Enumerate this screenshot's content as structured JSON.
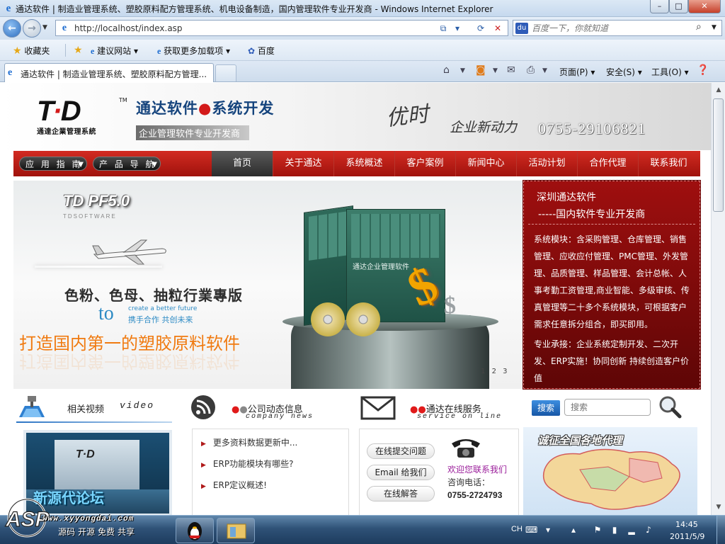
{
  "window": {
    "title": "通达软件 | 制造业管理系统、塑胶原料配方管理系统、机电设备制造，国内管理软件专业开发商 - Windows Internet Explorer"
  },
  "address_bar": {
    "url": "http://localhost/index.asp",
    "search_placeholder": "百度一下，你就知道"
  },
  "favorites_bar": {
    "favorites_label": "收藏夹",
    "items": [
      "建议网站",
      "获取更多加载项",
      "百度"
    ]
  },
  "tabs": [
    {
      "label": "通达软件 | 制造业管理系统、塑胶原料配方管理..."
    }
  ],
  "command_bar": {
    "page": "页面(P)",
    "safety": "安全(S)",
    "tools": "工具(O)"
  },
  "header": {
    "logo_mark": "T·D",
    "logo_tm": "TM",
    "logo_subtitle": "通達企業管理系統",
    "brand_part1": "通达软件",
    "brand_part2": "系统开发",
    "brand_subtitle": "企业管理软件专业开发商",
    "slogan_script": "优时",
    "slogan_script2": "企业新动力",
    "phone": "0755-29106821"
  },
  "nav": {
    "guide_buttons": [
      "应 用 指 南",
      "产 品 导 航"
    ],
    "items": [
      "首页",
      "关于通达",
      "系统概述",
      "客户案例",
      "新闻中心",
      "活动计划",
      "合作代理",
      "联系我们"
    ],
    "active_index": 0
  },
  "banner": {
    "product_name": "TD PF5.0",
    "product_sub": "TDSOFTWARE",
    "edition": "色粉、色母、抽粒行業專版",
    "to": "to",
    "tagline_en": "create a better future",
    "tagline_cn": "携手合作 共创未来",
    "headline": "打造国内第一的塑胶原料软件",
    "box_title": "通达企业管理软件",
    "slides": [
      "1",
      "2",
      "3"
    ]
  },
  "side_panel": {
    "title": "深圳通达软件",
    "subtitle": "-----国内软件专业开发商",
    "modules_text": "系统模块：含采购管理、仓库管理、销售管理、应收应付管理、PMC管理、外发管理、品质管理、样品管理、会计总帐、人事考勤工资管理,商业智能、多级审核、传真管理等二十多个系统模块，可根据客户需求任意拆分组合，即买即用。",
    "services_text": "专业承接：企业系统定制开发、二次开发、ERP实施！协同创新 持续创造客户价值"
  },
  "video_section": {
    "title": "相关视频",
    "title_en": "video",
    "overlay_caption": "新源代论坛"
  },
  "news_section": {
    "title": "公司动态信息",
    "title_en": "company news",
    "items": [
      "更多资料数据更新中...",
      "ERP功能模块有哪些?",
      "ERP定议概述!"
    ]
  },
  "service_section": {
    "title": "通达在线服务",
    "title_en": "service on line",
    "buttons": [
      "在线提交问题",
      "Email 给我们",
      "在线解答"
    ],
    "welcome": "欢迎您联系我们",
    "tel_label": "咨询电话：",
    "tel": "0755-2724793"
  },
  "search_section": {
    "button": "搜索",
    "placeholder": "搜索",
    "map_title": "诚征全国各地代理"
  },
  "watermark": {
    "site": "ASP",
    "url": "www.xyyongdai.com"
  },
  "taskbar": {
    "tags": [
      "源码",
      "开源",
      "免费",
      "共享"
    ],
    "lang": "CH",
    "time": "14:45",
    "date": "2011/5/9"
  },
  "colors": {
    "nav_red": "#c01b14",
    "panel_red": "#8c0d0d",
    "brand_blue": "#15447d",
    "headline_orange": "#f07a10",
    "tagline_blue": "#2c8ac4"
  }
}
